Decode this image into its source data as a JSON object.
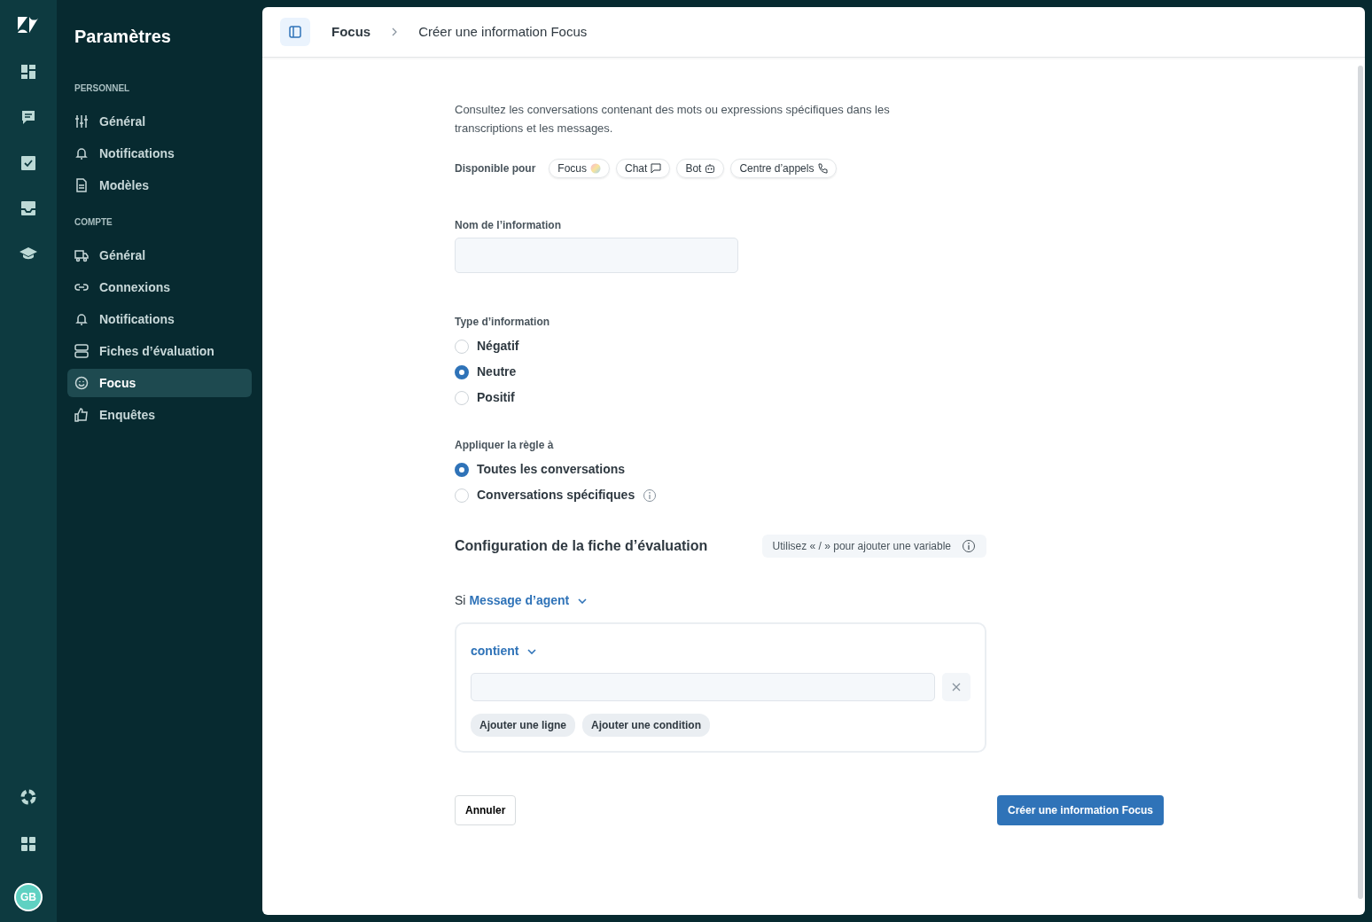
{
  "app": {
    "avatar_initials": "GB"
  },
  "settings_nav": {
    "title": "Paramètres",
    "sections": [
      {
        "heading": "PERSONNEL",
        "items": [
          {
            "label": "Général",
            "selected": false
          },
          {
            "label": "Notifications",
            "selected": false
          },
          {
            "label": "Modèles",
            "selected": false
          }
        ]
      },
      {
        "heading": "COMPTE",
        "items": [
          {
            "label": "Général",
            "selected": false
          },
          {
            "label": "Connexions",
            "selected": false
          },
          {
            "label": "Notifications",
            "selected": false
          },
          {
            "label": "Fiches d’évaluation",
            "selected": false
          },
          {
            "label": "Focus",
            "selected": true
          },
          {
            "label": "Enquêtes",
            "selected": false
          }
        ]
      }
    ]
  },
  "breadcrumb": [
    "Focus",
    "Créer une information Focus"
  ],
  "description": "Consultez les conversations contenant des mots ou expressions spécifiques dans les transcriptions et les messages.",
  "available_for": {
    "label": "Disponible pour",
    "chips": [
      "Focus",
      "Chat",
      "Bot",
      "Centre d’appels"
    ]
  },
  "name_field": {
    "label": "Nom de l’information"
  },
  "info_type": {
    "label": "Type d’information",
    "options": [
      {
        "label": "Négatif",
        "selected": false
      },
      {
        "label": "Neutre",
        "selected": true
      },
      {
        "label": "Positif",
        "selected": false
      }
    ]
  },
  "apply_rule": {
    "label": "Appliquer la règle à",
    "options": [
      {
        "label": "Toutes les conversations",
        "selected": true,
        "info": false
      },
      {
        "label": "Conversations spécifiques",
        "selected": false,
        "info": true
      }
    ]
  },
  "config": {
    "title": "Configuration de la fiche d’évaluation",
    "hint": "Utilisez « / » pour ajouter une variable",
    "if_label": "Si",
    "source": "Message d’agent",
    "operator": "contient",
    "actions": [
      "Ajouter une ligne",
      "Ajouter une condition"
    ]
  },
  "footer": {
    "cancel": "Annuler",
    "submit": "Créer une information Focus"
  }
}
